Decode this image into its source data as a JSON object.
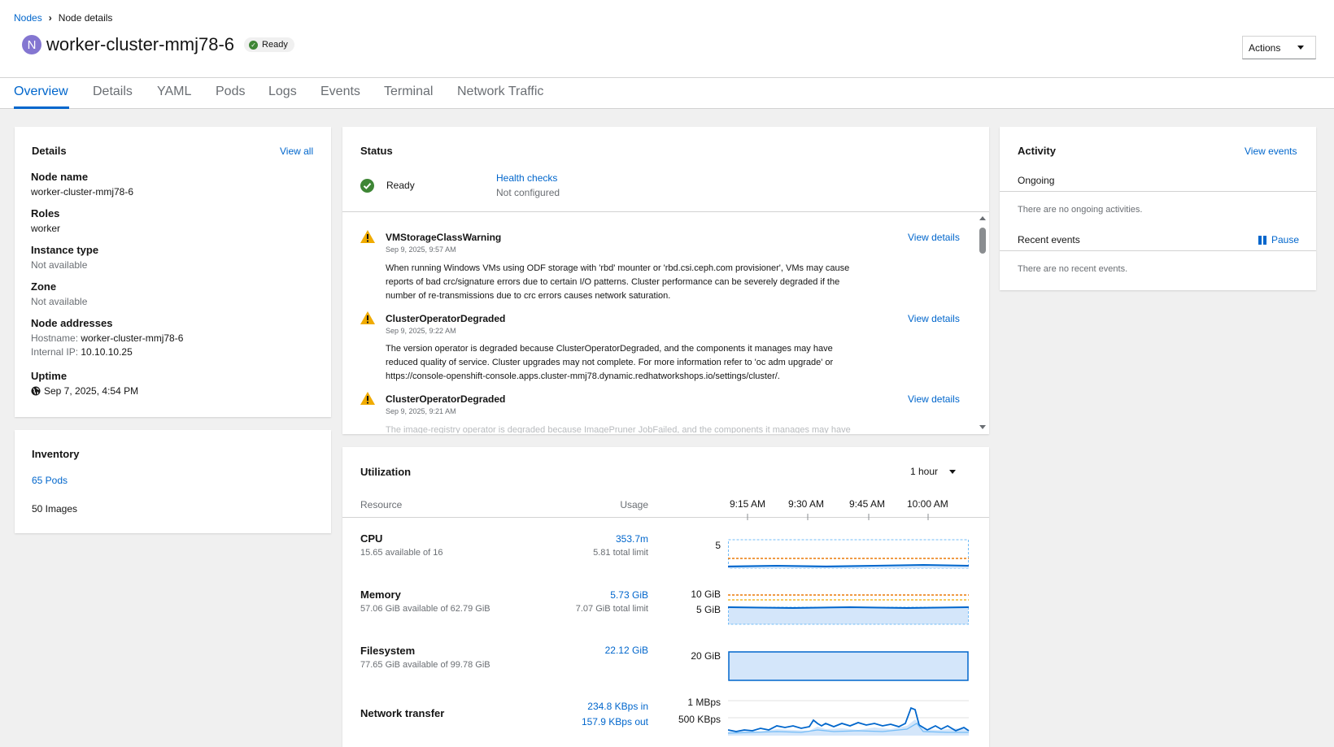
{
  "breadcrumb": {
    "parent": "Nodes",
    "current": "Node details"
  },
  "header": {
    "kind_badge": "N",
    "title": "worker-cluster-mmj78-6",
    "status": "Ready",
    "actions_label": "Actions"
  },
  "tabs": [
    "Overview",
    "Details",
    "YAML",
    "Pods",
    "Logs",
    "Events",
    "Terminal",
    "Network Traffic"
  ],
  "details": {
    "title": "Details",
    "view_all": "View all",
    "node_name_label": "Node name",
    "node_name": "worker-cluster-mmj78-6",
    "roles_label": "Roles",
    "roles": "worker",
    "instance_type_label": "Instance type",
    "instance_type": "Not available",
    "zone_label": "Zone",
    "zone": "Not available",
    "addresses_label": "Node addresses",
    "hostname_key": "Hostname:",
    "hostname": "worker-cluster-mmj78-6",
    "internal_ip_key": "Internal IP:",
    "internal_ip": "10.10.10.25",
    "uptime_label": "Uptime",
    "uptime": "Sep 7, 2025, 4:54 PM"
  },
  "inventory": {
    "title": "Inventory",
    "pods": "65 Pods",
    "images": "50 Images"
  },
  "status": {
    "title": "Status",
    "ready": "Ready",
    "health_checks": "Health checks",
    "health_checks_sub": "Not configured",
    "alerts": [
      {
        "name": "VMStorageClassWarning",
        "time": "Sep 9, 2025, 9:57 AM",
        "lines": [
          "When running Windows VMs using ODF storage with 'rbd' mounter or 'rbd.csi.ceph.com provisioner', VMs may cause",
          "reports of bad crc/signature errors due to certain I/O patterns. Cluster performance can be severely degraded if the",
          "number of re-transmissions due to crc errors causes network saturation."
        ],
        "link": "View details"
      },
      {
        "name": "ClusterOperatorDegraded",
        "time": "Sep 9, 2025, 9:22 AM",
        "lines": [
          "The version operator is degraded because ClusterOperatorDegraded, and the components it manages may have",
          "reduced quality of service. Cluster upgrades may not complete. For more information refer to 'oc adm upgrade' or",
          "https://console-openshift-console.apps.cluster-mmj78.dynamic.redhatworkshops.io/settings/cluster/."
        ],
        "link": "View details"
      },
      {
        "name": "ClusterOperatorDegraded",
        "time": "Sep 9, 2025, 9:21 AM",
        "lines": [
          "The image-registry operator is degraded because ImagePruner JobFailed, and the components it manages may have"
        ],
        "link": "View details"
      }
    ]
  },
  "activity": {
    "title": "Activity",
    "view_events": "View events",
    "ongoing": "Ongoing",
    "no_ongoing": "There are no ongoing activities.",
    "recent": "Recent events",
    "pause": "Pause",
    "no_recent": "There are no recent events."
  },
  "utilization": {
    "title": "Utilization",
    "range": "1 hour",
    "col_resource": "Resource",
    "col_usage": "Usage",
    "times": [
      "9:15 AM",
      "9:30 AM",
      "9:45 AM",
      "10:00 AM"
    ],
    "cpu": {
      "label": "CPU",
      "sub": "15.65 available of 16",
      "value": "353.7m",
      "limit": "5.81 total limit",
      "axis": "5"
    },
    "memory": {
      "label": "Memory",
      "sub": "57.06 GiB available of 62.79 GiB",
      "value": "5.73 GiB",
      "limit": "7.07 GiB total limit",
      "axis_top": "10 GiB",
      "axis_mid": "5 GiB"
    },
    "filesystem": {
      "label": "Filesystem",
      "sub": "77.65 GiB available of 99.78 GiB",
      "value": "22.12 GiB",
      "axis": "20 GiB"
    },
    "network": {
      "label": "Network transfer",
      "in": "234.8 KBps in",
      "out": "157.9 KBps out",
      "axis_top": "1 MBps",
      "axis_mid": "500 KBps"
    }
  },
  "colors": {
    "link": "#0066cc",
    "ok": "#3e8635",
    "warning": "#f0ab00",
    "chart_fill": "#d4e6fa",
    "chart_line": "#0066cc",
    "limit": "#ec7a08"
  }
}
